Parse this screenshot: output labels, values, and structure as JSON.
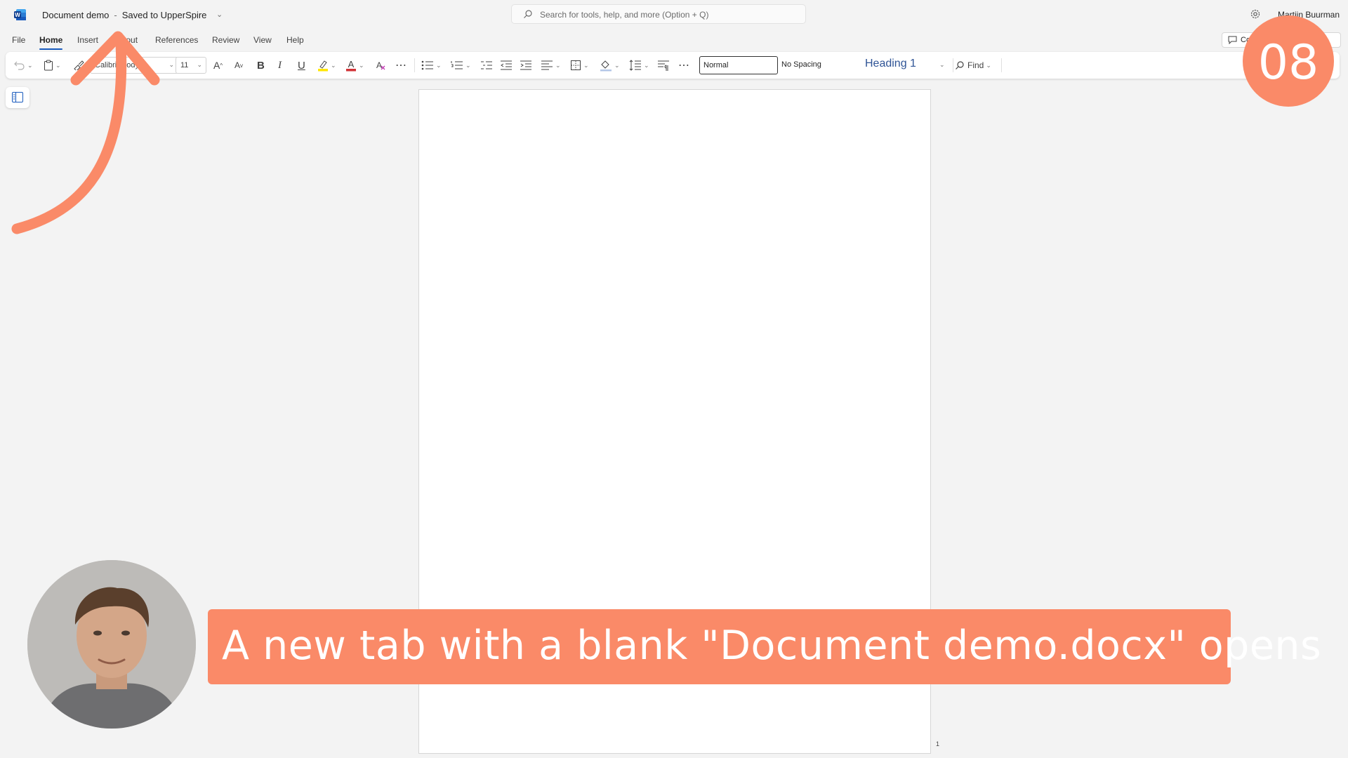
{
  "app": {
    "logo_letter": "W",
    "doc_name": "Document demo",
    "separator": "-",
    "save_status": "Saved to UpperSpire",
    "search_placeholder": "Search for tools, help, and more (Option + Q)",
    "user_name": "Martijn Buurman"
  },
  "menu": {
    "tabs": [
      {
        "label": "File"
      },
      {
        "label": "Home",
        "active": true
      },
      {
        "label": "Insert"
      },
      {
        "label": "Layout"
      },
      {
        "label": "References"
      },
      {
        "label": "Review"
      },
      {
        "label": "View"
      },
      {
        "label": "Help"
      }
    ],
    "comments_label": "Comments"
  },
  "ribbon": {
    "font_name": "Calibri (Body)",
    "font_size": "11",
    "grow_font": "A",
    "shrink_font": "A",
    "bold": "B",
    "italic": "I",
    "underline": "U",
    "font_color_letter": "A",
    "more": "⋯",
    "styles": {
      "normal": "Normal",
      "no_spacing": "No Spacing",
      "heading1": "Heading 1"
    },
    "find_label": "Find",
    "colors": {
      "highlight": "#ffe600",
      "font_color": "#d13438",
      "accent": "#185abd",
      "heading_blue": "#2f5496"
    }
  },
  "document": {
    "page_number": "1"
  },
  "overlay": {
    "step_number": "08",
    "caption": "A new tab with a blank \"Document demo.docx\" opens",
    "accent_color": "#fa8a68"
  }
}
